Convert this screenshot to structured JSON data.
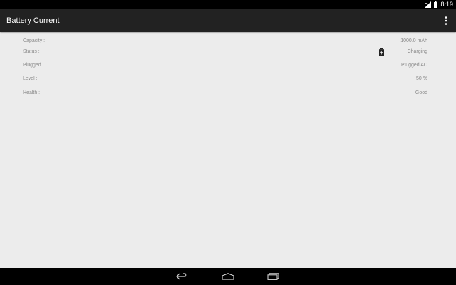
{
  "status_bar": {
    "time": "8:19",
    "icons": [
      "signal-icon",
      "battery-icon"
    ]
  },
  "action_bar": {
    "title": "Battery Current",
    "overflow_icon": "overflow-menu-icon"
  },
  "battery_info": [
    {
      "label": "Capacity :",
      "value": "1000.0 mAh"
    },
    {
      "label": "Status :",
      "value": "Charging"
    },
    {
      "label": "Plugged :",
      "value": "Plugged AC"
    },
    {
      "label": "Level :",
      "value": "50 %"
    },
    {
      "label": "Health :",
      "value": "Good"
    }
  ],
  "nav_bar": {
    "buttons": [
      "back-icon",
      "home-icon",
      "recent-apps-icon"
    ]
  },
  "colors": {
    "action_bar": "#222222",
    "background": "#ececec",
    "text_secondary": "#8a8a8a"
  }
}
